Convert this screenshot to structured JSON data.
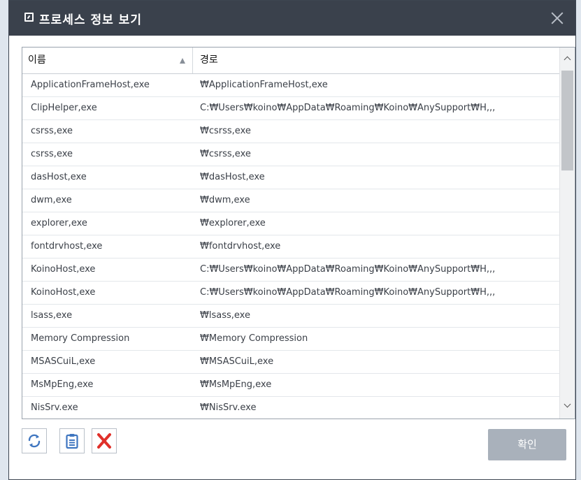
{
  "window": {
    "title": "프로세스 정보 보기",
    "title_icon": "window-edit-icon",
    "close_icon": "close-icon"
  },
  "table": {
    "columns": [
      "이름",
      "경로"
    ],
    "sort_icon": "sort-ascending-icon",
    "rows": [
      {
        "name": "ApplicationFrameHost,exe",
        "path": "₩ApplicationFrameHost,exe"
      },
      {
        "name": "ClipHelper,exe",
        "path": "C:₩Users₩koino₩AppData₩Roaming₩Koino₩AnySupport₩H,,,"
      },
      {
        "name": "csrss,exe",
        "path": "₩csrss,exe"
      },
      {
        "name": "csrss,exe",
        "path": "₩csrss,exe"
      },
      {
        "name": "dasHost,exe",
        "path": "₩dasHost,exe"
      },
      {
        "name": "dwm,exe",
        "path": "₩dwm,exe"
      },
      {
        "name": "explorer,exe",
        "path": "₩explorer,exe"
      },
      {
        "name": "fontdrvhost,exe",
        "path": "₩fontdrvhost,exe"
      },
      {
        "name": "KoinoHost,exe",
        "path": "C:₩Users₩koino₩AppData₩Roaming₩Koino₩AnySupport₩H,,,"
      },
      {
        "name": "KoinoHost,exe",
        "path": "C:₩Users₩koino₩AppData₩Roaming₩Koino₩AnySupport₩H,,,"
      },
      {
        "name": "lsass,exe",
        "path": "₩lsass,exe"
      },
      {
        "name": "Memory Compression",
        "path": "₩Memory Compression"
      },
      {
        "name": "MSASCuiL,exe",
        "path": "₩MSASCuiL,exe"
      },
      {
        "name": "MsMpEng,exe",
        "path": "₩MsMpEng,exe"
      },
      {
        "name": "NisSrv.exe",
        "path": "₩NisSrv.exe"
      }
    ]
  },
  "toolbar": {
    "refresh_icon": "refresh-icon",
    "copy_icon": "clipboard-icon",
    "delete_icon": "delete-x-icon"
  },
  "confirm_label": "확인",
  "colors": {
    "titlebar": "#3a414c",
    "delete_red": "#e0302a",
    "icon_blue": "#3f76c0",
    "confirm_bg": "#a9b1bb"
  }
}
